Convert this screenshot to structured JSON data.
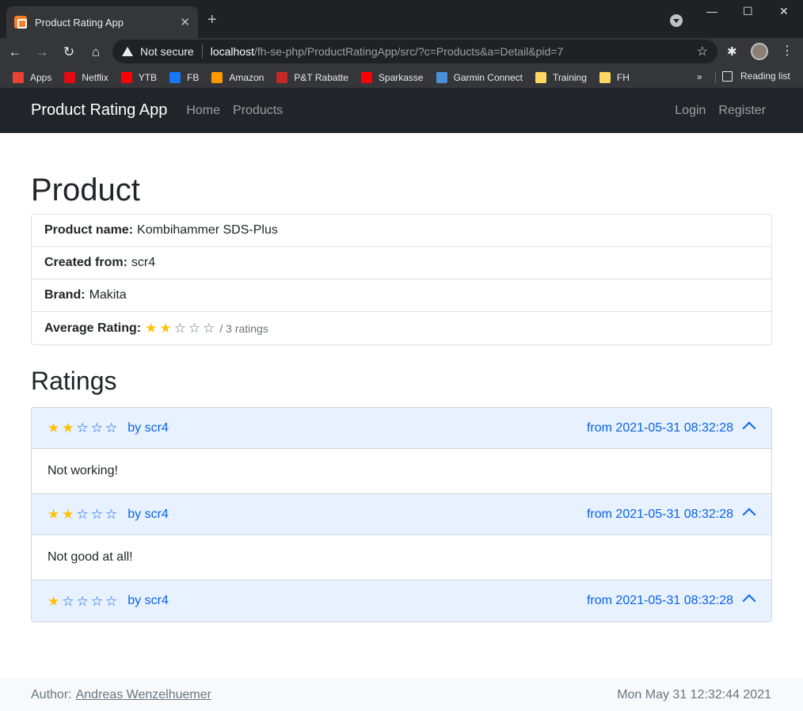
{
  "browser": {
    "tab_title": "Product Rating App",
    "security_label": "Not secure",
    "url_host": "localhost",
    "url_path": "/fh-se-php/ProductRatingApp/src/?c=Products&a=Detail&pid=7",
    "bookmarks": [
      {
        "label": "Apps",
        "color": "#ea4335"
      },
      {
        "label": "Netflix",
        "color": "#e50914"
      },
      {
        "label": "YTB",
        "color": "#ff0000"
      },
      {
        "label": "FB",
        "color": "#1877f2"
      },
      {
        "label": "Amazon",
        "color": "#ff9900"
      },
      {
        "label": "P&T Rabatte",
        "color": "#c62828"
      },
      {
        "label": "Sparkasse",
        "color": "#ff0000"
      },
      {
        "label": "Garmin Connect",
        "color": "#4a90d9"
      },
      {
        "label": "Training",
        "color": "#fdd663"
      },
      {
        "label": "FH",
        "color": "#fdd663"
      }
    ],
    "more_bookmarks": "»",
    "reading_list": "Reading list"
  },
  "navbar": {
    "brand": "Product Rating App",
    "home": "Home",
    "products": "Products",
    "login": "Login",
    "register": "Register"
  },
  "product": {
    "heading": "Product",
    "name_label": "Product name:",
    "name_value": "Kombihammer SDS-Plus",
    "created_label": "Created from:",
    "created_value": "scr4",
    "brand_label": "Brand:",
    "brand_value": "Makita",
    "avg_label": "Average Rating:",
    "avg_stars": 2,
    "avg_count_text": "/ 3 ratings"
  },
  "ratings": {
    "heading": "Ratings",
    "items": [
      {
        "stars": 2,
        "by": "by scr4",
        "from": "from 2021-05-31 08:32:28",
        "comment": "Not working!"
      },
      {
        "stars": 2,
        "by": "by scr4",
        "from": "from 2021-05-31 08:32:28",
        "comment": "Not good at all!"
      },
      {
        "stars": 1,
        "by": "by scr4",
        "from": "from 2021-05-31 08:32:28",
        "comment": ""
      }
    ]
  },
  "footer": {
    "author_label": "Author:",
    "author_name": "Andreas Wenzelhuemer",
    "date": "Mon May 31 12:32:44 2021"
  }
}
